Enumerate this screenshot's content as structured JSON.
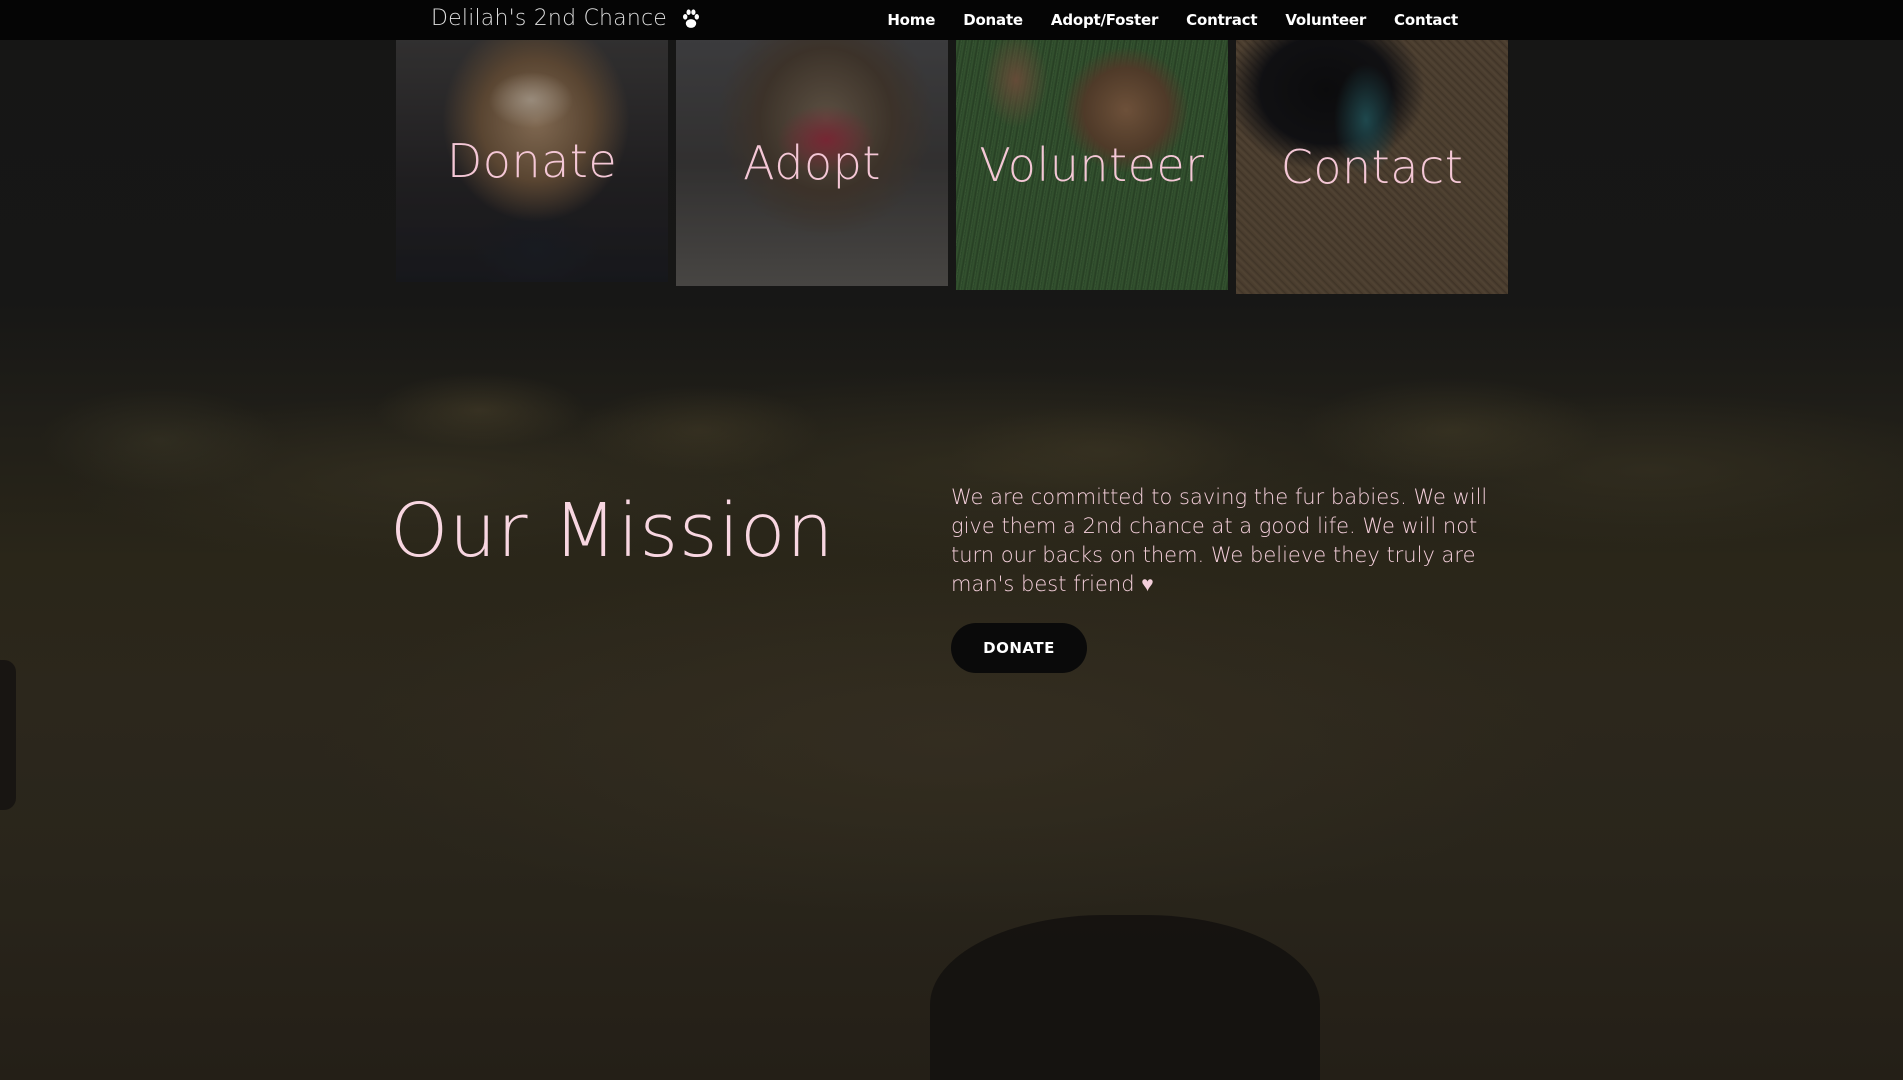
{
  "header": {
    "brand": "Delilah's 2nd Chance",
    "brand_icon": "paw-icon",
    "nav": [
      {
        "label": "Home"
      },
      {
        "label": "Donate"
      },
      {
        "label": "Adopt/Foster"
      },
      {
        "label": "Contract"
      },
      {
        "label": "Volunteer"
      },
      {
        "label": "Contact"
      }
    ]
  },
  "tiles": [
    {
      "label": "Donate"
    },
    {
      "label": "Adopt"
    },
    {
      "label": "Volunteer"
    },
    {
      "label": "Contact"
    }
  ],
  "mission": {
    "title": "Our Mission",
    "text": "We are committed to saving the fur babies. We will give them a 2nd chance at a good life. We will not turn our backs on them. We believe they truly are man's best friend ♥",
    "button_label": "DONATE"
  },
  "colors": {
    "accent_pink": "#f4c7d6",
    "navbar": "#050505",
    "button": "#0a0a0a"
  }
}
